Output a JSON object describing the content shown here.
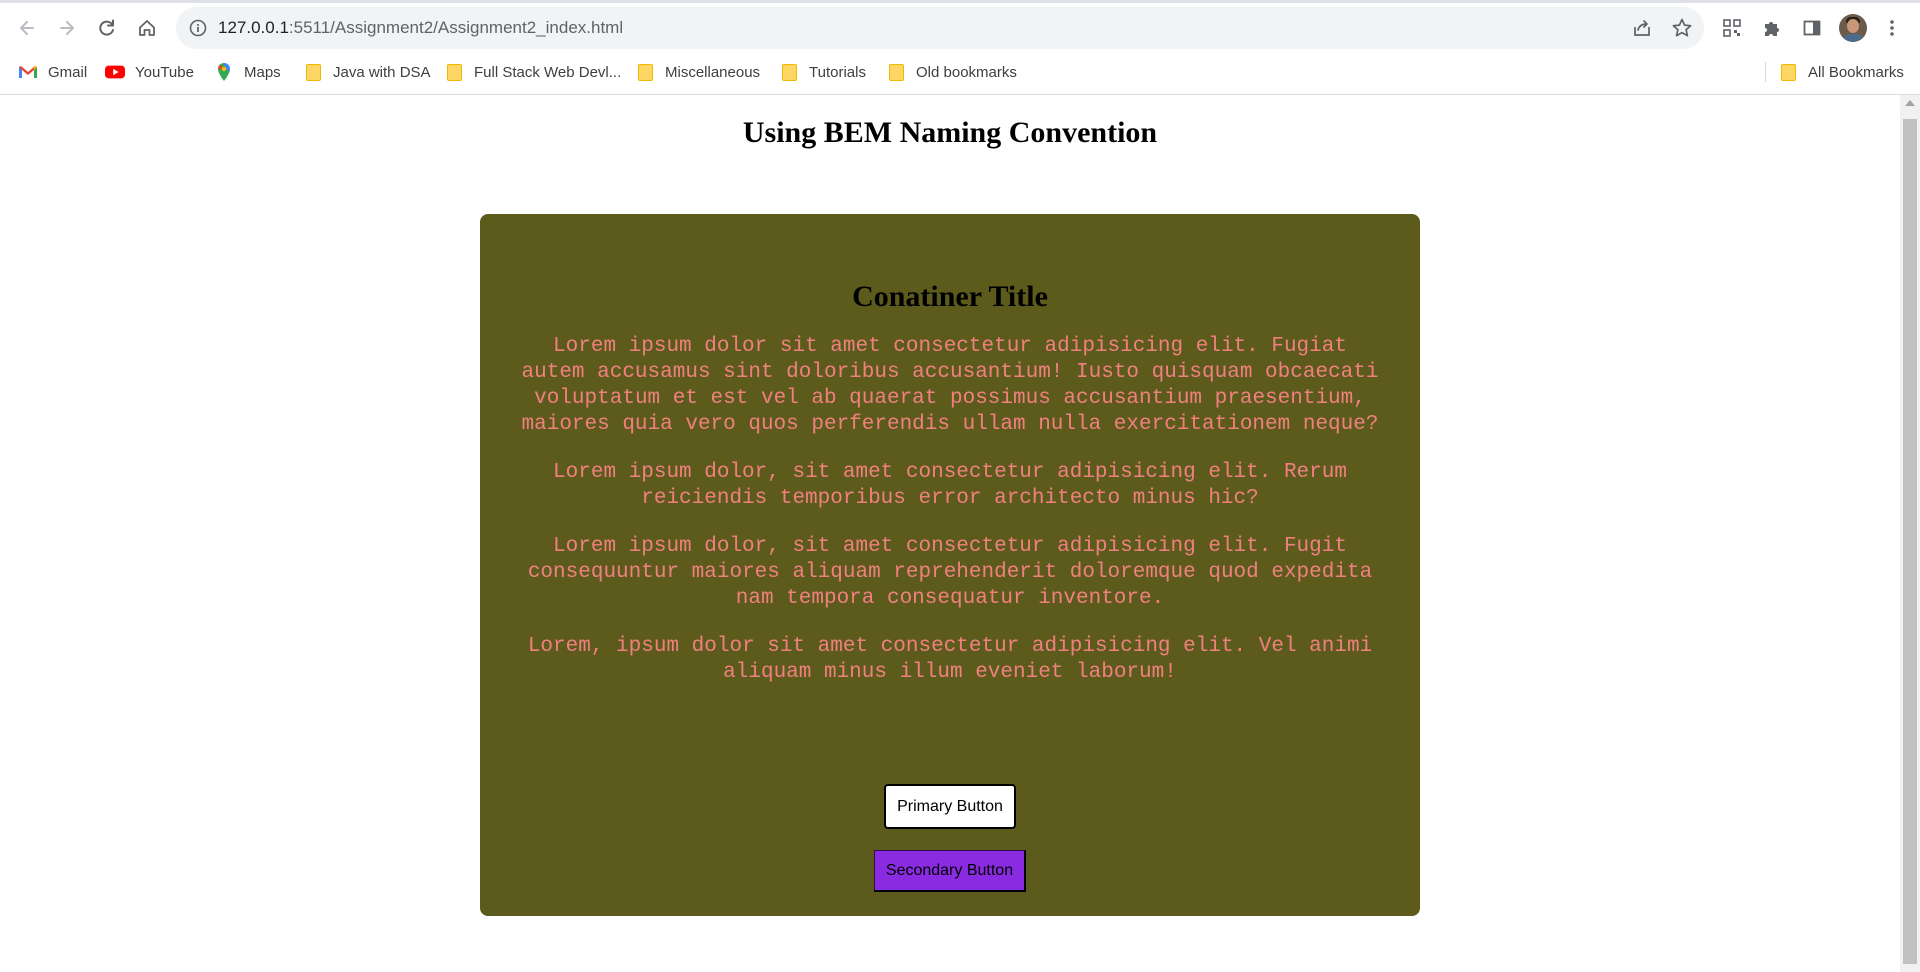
{
  "browser": {
    "url": {
      "host": "127.0.0.1",
      "path": ":5511/Assignment2/Assignment2_index.html"
    },
    "icons": {
      "back": "arrow-left-icon",
      "forward": "arrow-right-icon",
      "reload": "reload-icon",
      "home": "home-icon",
      "site_info": "info-icon",
      "share": "share-icon",
      "bookmark_star": "star-icon",
      "qr": "qr-code-icon",
      "extensions": "puzzle-icon",
      "side_panel": "side-panel-icon",
      "menu": "kebab-menu-icon"
    },
    "bookmarks": [
      {
        "label": "Gmail",
        "icon": "gmail-icon"
      },
      {
        "label": "YouTube",
        "icon": "youtube-icon"
      },
      {
        "label": "Maps",
        "icon": "maps-icon"
      },
      {
        "label": "Java with DSA",
        "icon": "folder-icon"
      },
      {
        "label": "Full Stack Web Devl...",
        "icon": "folder-icon"
      },
      {
        "label": "Miscellaneous",
        "icon": "folder-icon"
      },
      {
        "label": "Tutorials",
        "icon": "folder-icon"
      },
      {
        "label": "Old bookmarks",
        "icon": "folder-icon"
      }
    ],
    "all_bookmarks": "All Bookmarks"
  },
  "page": {
    "heading": "Using BEM Naming Convention",
    "container": {
      "title": "Conatiner Title",
      "paragraphs": [
        "Lorem ipsum dolor sit amet consectetur adipisicing elit. Fugiat autem accusamus sint doloribus accusantium! Iusto quisquam obcaecati voluptatum et est vel ab quaerat possimus accusantium praesentium, maiores quia vero quos perferendis ullam nulla exercitationem neque?",
        "Lorem ipsum dolor, sit amet consectetur adipisicing elit. Rerum reiciendis temporibus error architecto minus hic?",
        "Lorem ipsum dolor, sit amet consectetur adipisicing elit. Fugit consequuntur maiores aliquam reprehenderit doloremque quod expedita nam tempora consequatur inventore.",
        "Lorem, ipsum dolor sit amet consectetur adipisicing elit. Vel animi aliquam minus illum eveniet laborum!"
      ],
      "primary_button": "Primary Button",
      "secondary_button": "Secondary Button"
    }
  },
  "colors": {
    "container_bg": "#5c5b1b",
    "paragraph_text": "#f08080",
    "secondary_button_bg": "#8a2be2",
    "primary_button_bg": "#ffffff"
  }
}
